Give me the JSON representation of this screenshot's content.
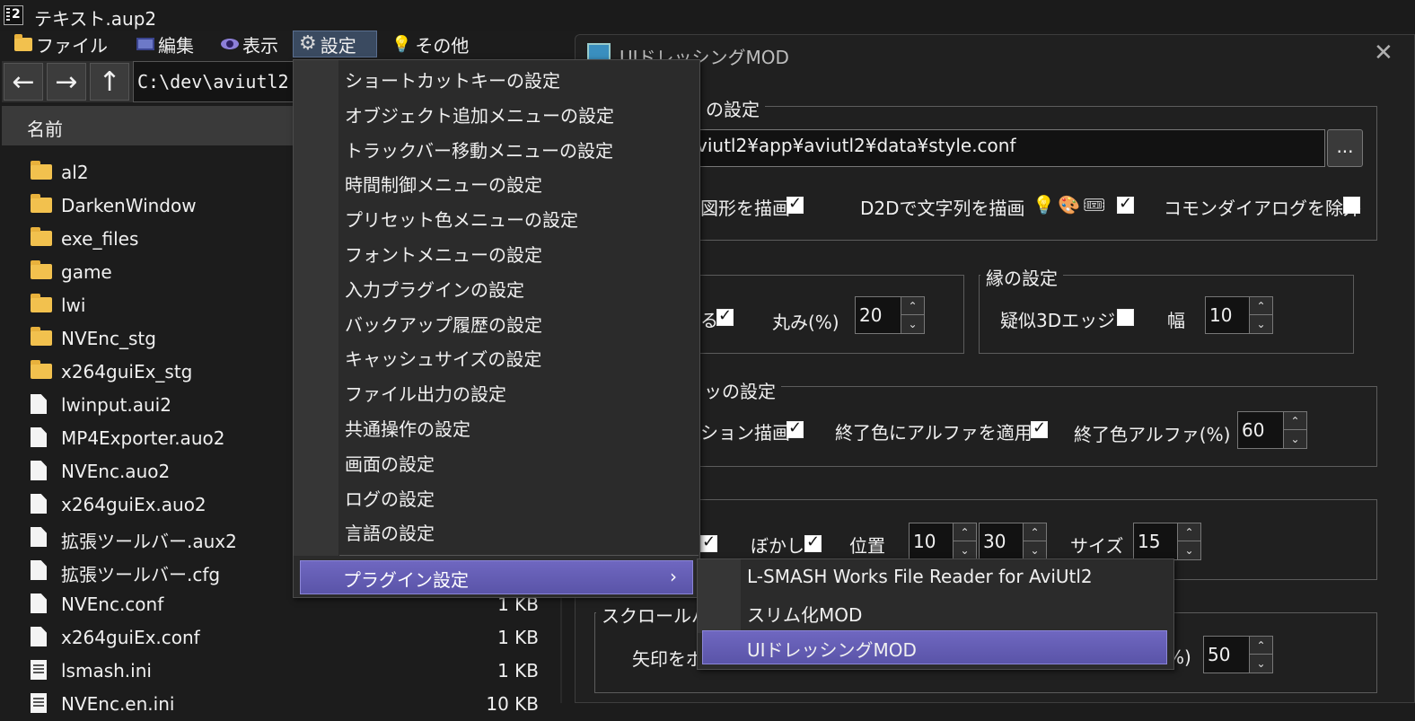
{
  "window": {
    "title": "テキスト.aup2"
  },
  "menubar": [
    {
      "label": "ファイル",
      "icon": "folder-icon"
    },
    {
      "label": "編集",
      "icon": "film-icon"
    },
    {
      "label": "表示",
      "icon": "eye-icon"
    },
    {
      "label": "設定",
      "icon": "gear-icon",
      "active": true
    },
    {
      "label": "その他",
      "icon": "bulb-icon"
    }
  ],
  "explorer": {
    "nav": {
      "back": "←",
      "forward": "→",
      "up": "↑"
    },
    "path": "C:\\dev\\aviutl2",
    "column_name": "名前",
    "files": [
      {
        "name": "al2",
        "type": "folder",
        "size": ""
      },
      {
        "name": "DarkenWindow",
        "type": "folder",
        "size": ""
      },
      {
        "name": "exe_files",
        "type": "folder",
        "size": ""
      },
      {
        "name": "game",
        "type": "folder",
        "size": ""
      },
      {
        "name": "lwi",
        "type": "folder",
        "size": ""
      },
      {
        "name": "NVEnc_stg",
        "type": "folder",
        "size": ""
      },
      {
        "name": "x264guiEx_stg",
        "type": "folder",
        "size": ""
      },
      {
        "name": "lwinput.aui2",
        "type": "doc",
        "size": ""
      },
      {
        "name": "MP4Exporter.auo2",
        "type": "doc",
        "size": ""
      },
      {
        "name": "NVEnc.auo2",
        "type": "doc",
        "size": ""
      },
      {
        "name": "x264guiEx.auo2",
        "type": "doc",
        "size": ""
      },
      {
        "name": "拡張ツールバー.aux2",
        "type": "doc",
        "size": ""
      },
      {
        "name": "拡張ツールバー.cfg",
        "type": "doc",
        "size": ""
      },
      {
        "name": "NVEnc.conf",
        "type": "doc",
        "size": "1 KB"
      },
      {
        "name": "x264guiEx.conf",
        "type": "doc",
        "size": "1 KB"
      },
      {
        "name": "lsmash.ini",
        "type": "ini",
        "size": "1 KB"
      },
      {
        "name": "NVEnc.en.ini",
        "type": "ini",
        "size": "10 KB"
      }
    ]
  },
  "dialog": {
    "title": "UIドレッシングMOD",
    "close": "✕",
    "group1": {
      "label": "の設定",
      "path": "viutl2¥app¥aviutl2¥data¥style.conf",
      "browse": "...",
      "opt_shape": "図形を描画",
      "opt_d2d": "D2Dで文字列を描画",
      "opt_common": "コモンダイアログを除外"
    },
    "group2": {
      "opt_round_tail": "る",
      "round_label": "丸み(%)",
      "round_value": "20"
    },
    "group_edge": {
      "label": "縁の設定",
      "pseudo3d": "疑似3Dエッジ",
      "width_label": "幅",
      "width_value": "10"
    },
    "group3": {
      "label": "の設定",
      "label_prefix": "ッ",
      "gradation": "ション描画",
      "apply_alpha": "終了色にアルファを適用",
      "end_alpha_label": "終了色アルファ(%)",
      "end_alpha_value": "60"
    },
    "group4": {
      "blur": "ぼかし",
      "pos_label": "位置",
      "pos_x": "10",
      "pos_y": "30",
      "size_label": "サイズ",
      "size_value": "15"
    },
    "group5": {
      "label": "スクロールバー",
      "arrow_label": "矢印をボ",
      "pct_tail": "%)",
      "value": "50"
    }
  },
  "settings_menu": {
    "items": [
      "ショートカットキーの設定",
      "オブジェクト追加メニューの設定",
      "トラックバー移動メニューの設定",
      "時間制御メニューの設定",
      "プリセット色メニューの設定",
      "フォントメニューの設定",
      "入力プラグインの設定",
      "バックアップ履歴の設定",
      "キャッシュサイズの設定",
      "ファイル出力の設定",
      "共通操作の設定",
      "画面の設定",
      "ログの設定",
      "言語の設定"
    ],
    "plugin_item": "プラグイン設定",
    "plugin_arrow": "›"
  },
  "plugin_submenu": [
    "L-SMASH Works File Reader for AviUtl2",
    "スリム化MOD",
    "UIドレッシングMOD"
  ]
}
